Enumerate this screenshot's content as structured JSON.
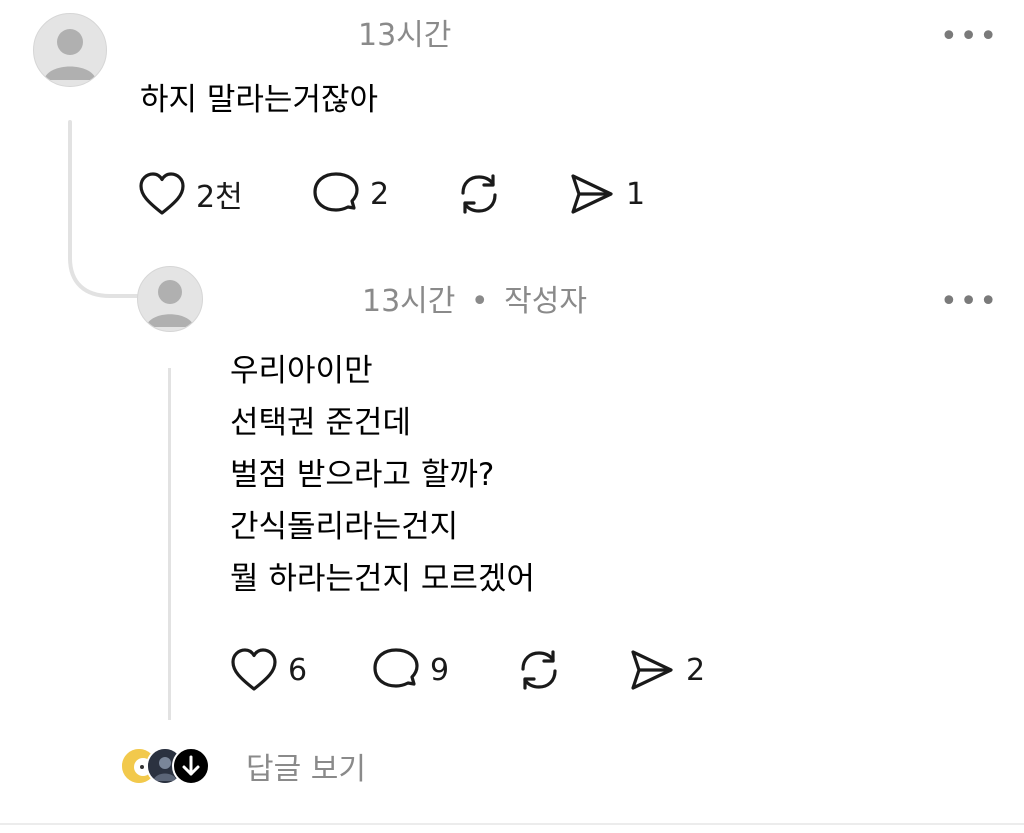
{
  "comment": {
    "time": "13시간",
    "text": "하지 말라는거잖아",
    "likes": "2천",
    "replies": "2",
    "shares": "1",
    "more_label": "•••"
  },
  "reply": {
    "time": "13시간",
    "separator": "•",
    "author_badge": "작성자",
    "lines": [
      "우리아이만",
      "선택권 준건데",
      "벌점 받으라고 할까?",
      "간식돌리라는건지",
      "뭘 하라는건지 모르겠어"
    ],
    "likes": "6",
    "replies": "9",
    "shares": "2",
    "more_label": "•••"
  },
  "footer": {
    "view_replies_label": "답글 보기"
  },
  "icons": {
    "like": "heart-icon",
    "reply": "speech-bubble-icon",
    "repost": "repost-icon",
    "share": "send-icon",
    "more": "more-horizontal-icon",
    "expand": "arrow-down-icon"
  },
  "colors": {
    "text": "#000000",
    "meta": "#8a8a8a",
    "thread_line": "#e2e2e2",
    "avatar_bg": "#e4e4e4",
    "avatar_fg": "#b0b0b0"
  }
}
